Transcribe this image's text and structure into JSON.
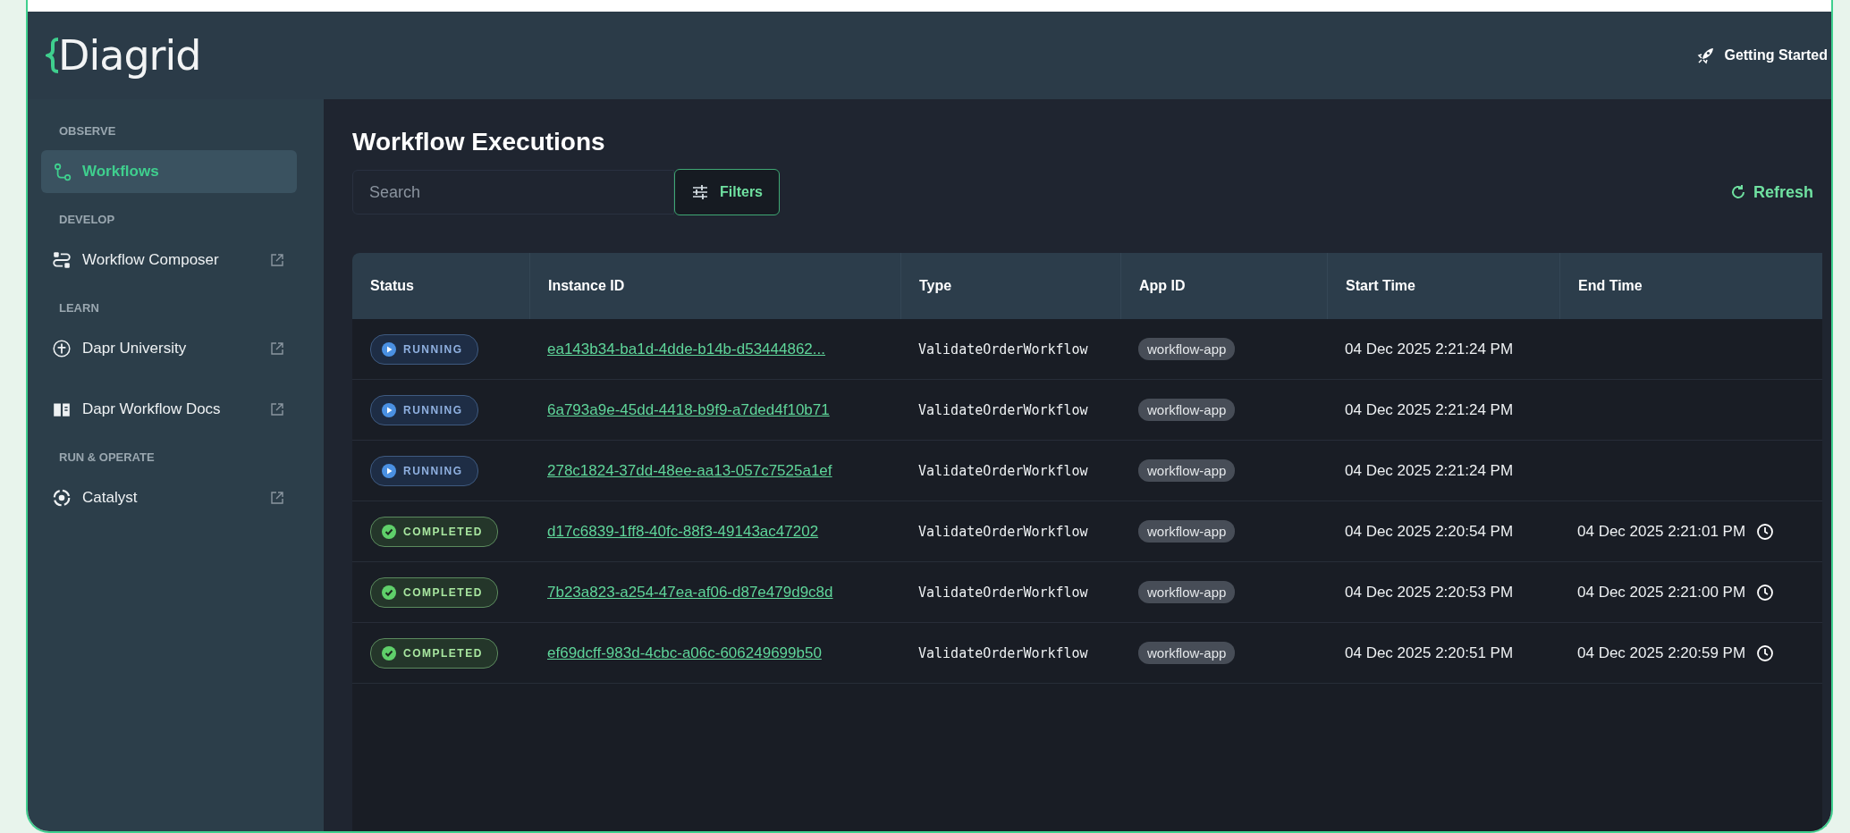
{
  "header": {
    "logo": "Diagrid",
    "getting_started": "Getting Started"
  },
  "sidebar": {
    "sections": [
      {
        "heading": "OBSERVE",
        "items": [
          {
            "label": "Workflows",
            "selected": true,
            "external": false
          }
        ]
      },
      {
        "heading": "DEVELOP",
        "items": [
          {
            "label": "Workflow Composer",
            "selected": false,
            "external": true
          }
        ]
      },
      {
        "heading": "LEARN",
        "items": [
          {
            "label": "Dapr University",
            "selected": false,
            "external": true
          },
          {
            "label": "Dapr Workflow Docs",
            "selected": false,
            "external": true
          }
        ]
      },
      {
        "heading": "RUN & OPERATE",
        "items": [
          {
            "label": "Catalyst",
            "selected": false,
            "external": true
          }
        ]
      }
    ]
  },
  "main": {
    "title": "Workflow Executions",
    "search": {
      "placeholder": "Search"
    },
    "filters_button": "Filters",
    "refresh_button": "Refresh"
  },
  "table": {
    "columns": [
      "Status",
      "Instance ID",
      "Type",
      "App ID",
      "Start Time",
      "End Time"
    ],
    "rows": [
      {
        "status": "RUNNING",
        "kind": "running",
        "instance_id": "ea143b34-ba1d-4dde-b14b-d53444862...",
        "type": "ValidateOrderWorkflow",
        "app_id": "workflow-app",
        "start_time": "04 Dec 2025 2:21:24 PM"
      },
      {
        "status": "RUNNING",
        "kind": "running",
        "instance_id": "6a793a9e-45dd-4418-b9f9-a7ded4f10b71",
        "type": "ValidateOrderWorkflow",
        "app_id": "workflow-app",
        "start_time": "04 Dec 2025 2:21:24 PM"
      },
      {
        "status": "RUNNING",
        "kind": "running",
        "instance_id": "278c1824-37dd-48ee-aa13-057c7525a1ef",
        "type": "ValidateOrderWorkflow",
        "app_id": "workflow-app",
        "start_time": "04 Dec 2025 2:21:24 PM"
      },
      {
        "status": "COMPLETED",
        "kind": "completed",
        "instance_id": "d17c6839-1ff8-40fc-88f3-49143ac47202",
        "type": "ValidateOrderWorkflow",
        "app_id": "workflow-app",
        "start_time": "04 Dec 2025 2:20:54 PM",
        "end_time": "04 Dec 2025 2:21:01 PM"
      },
      {
        "status": "COMPLETED",
        "kind": "completed",
        "instance_id": "7b23a823-a254-47ea-af06-d87e479d9c8d",
        "type": "ValidateOrderWorkflow",
        "app_id": "workflow-app",
        "start_time": "04 Dec 2025 2:20:53 PM",
        "end_time": "04 Dec 2025 2:21:00 PM"
      },
      {
        "status": "COMPLETED",
        "kind": "completed",
        "instance_id": "ef69dcff-983d-4cbc-a06c-606249699b50",
        "type": "ValidateOrderWorkflow",
        "app_id": "workflow-app",
        "start_time": "04 Dec 2025 2:20:51 PM",
        "end_time": "04 Dec 2025 2:20:59 PM"
      }
    ]
  }
}
